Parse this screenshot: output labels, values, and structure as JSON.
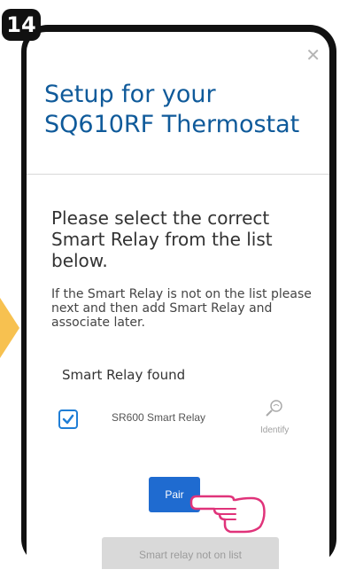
{
  "step_badge": "14",
  "title_line1": "Setup for your",
  "title_line2": "SQ610RF Thermostat",
  "instruction": "Please select the correct Smart Relay from the list below.",
  "note": "If the Smart Relay is not on the list please next and then add Smart Relay and associate later.",
  "found_label": "Smart Relay found",
  "relay": {
    "name": "SR600 Smart Relay",
    "checked": true
  },
  "identify_label": "Identify",
  "pair_label": "Pair",
  "not_on_list_label": "Smart relay not on list",
  "colors": {
    "title": "#0f5a9a",
    "accent": "#1f6bd0",
    "disabled": "#d9d9d9",
    "arrow": "#f7c150"
  },
  "icons": {
    "close": "close-icon",
    "check": "checkmark-icon",
    "identify": "identify-magnifier-icon",
    "hand": "pointing-hand-icon"
  }
}
